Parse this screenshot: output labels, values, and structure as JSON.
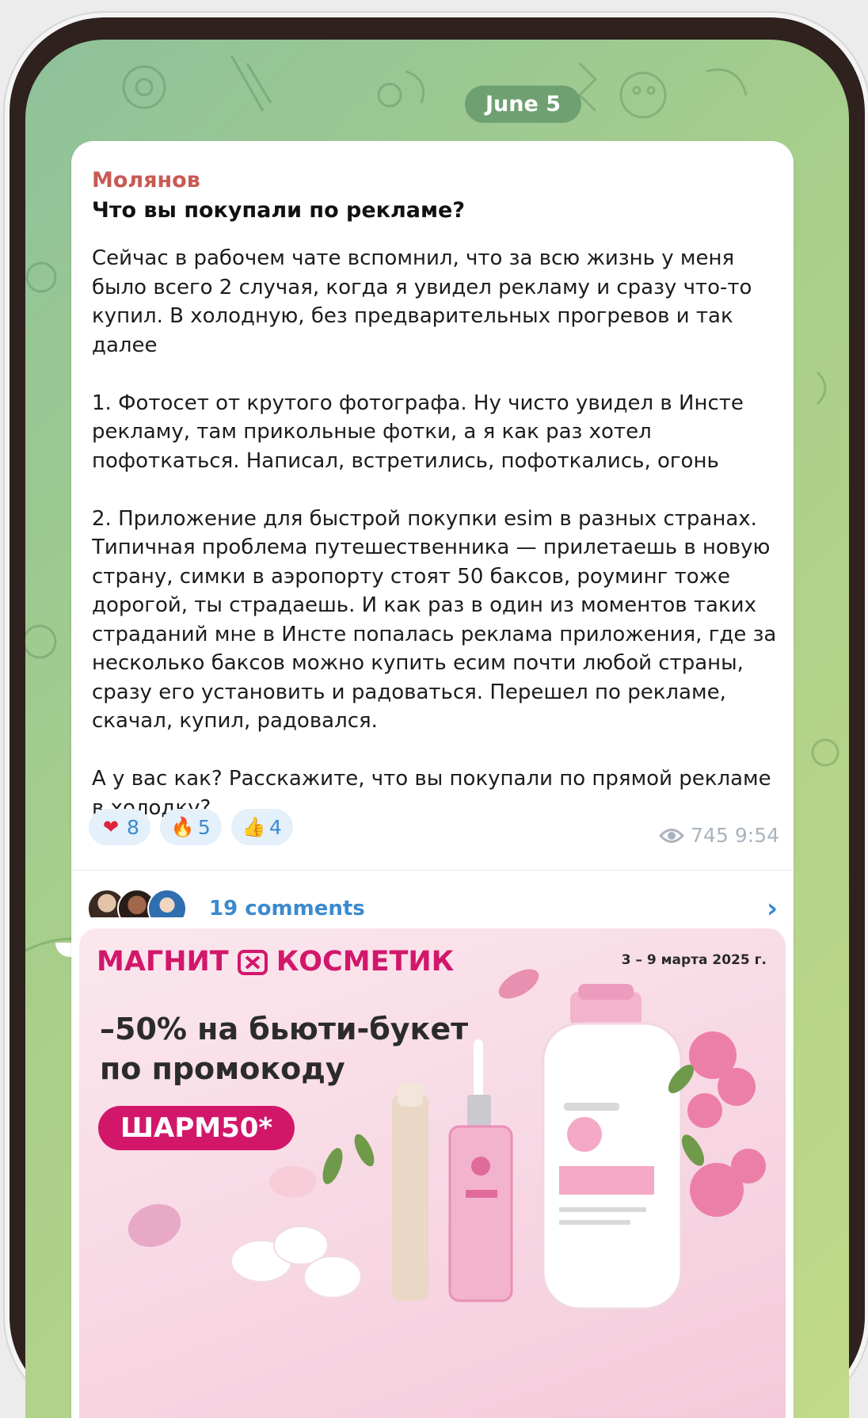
{
  "date_separator": "June 5",
  "post": {
    "sender": "Молянов",
    "headline": "Что вы покупали по рекламе?",
    "paragraphs": [
      "Сейчас в рабочем чате вспомнил, что за всю жизнь у меня было всего 2 случая, когда я увидел рекламу и сразу что-то купил. В холодную, без предварительных прогревов и так далее",
      "1. Фотосет от крутого фотографа. Ну чисто увидел в Инсте рекламу, там прикольные фотки, а я как раз хотел пофоткаться. Написал, встретились, пофоткались, огонь",
      "2. Приложение для быстрой покупки esim в разных странах. Типичная проблема путешественника — прилетаешь в новую страну, симки в аэропорту стоят 50 баксов, роуминг тоже дорогой, ты страдаешь. И как раз в один из моментов таких страданий мне в Инсте попалась реклама приложения, где за несколько баксов можно купить есим почти любой страны, сразу его установить и радоваться. Перешел по рекламе, скачал, купил, радовался.",
      "А у вас как? Расскажите, что вы покупали по прямой рекламе в холодку?"
    ],
    "reactions": [
      {
        "icon": "heart-icon",
        "emoji": "❤",
        "count": "8"
      },
      {
        "icon": "fire-icon",
        "emoji": "🔥",
        "count": "5"
      },
      {
        "icon": "thumbs-up-icon",
        "emoji": "👍",
        "count": "4"
      }
    ],
    "views": "745",
    "time": "9:54",
    "comments_label": "19 comments"
  },
  "ad": {
    "brand_left": "МАГНИТ",
    "brand_right": "КОСМЕТИК",
    "date_range": "3 – 9 марта 2025 г.",
    "headline_line1": "–50% на бьюти-букет",
    "headline_line2": "по промокоду",
    "promo_code": "ШАРМ50*"
  },
  "colors": {
    "sender": "#c85a53",
    "link": "#3a8ad0",
    "brand": "#d2176b",
    "date_pill": "#6fa072"
  }
}
